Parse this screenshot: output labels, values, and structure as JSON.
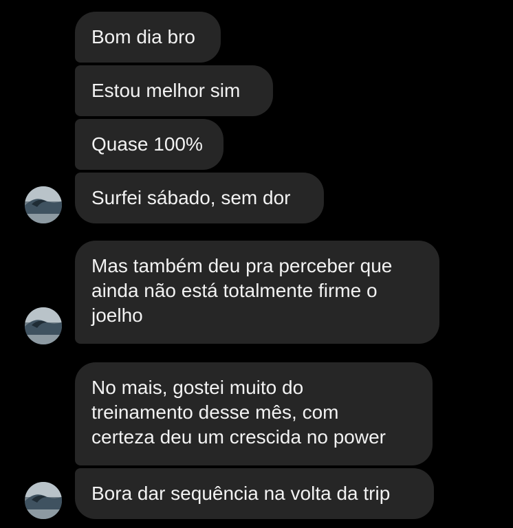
{
  "messages": [
    {
      "lines": [
        "Bom dia bro"
      ]
    },
    {
      "lines": [
        "Estou melhor sim"
      ]
    },
    {
      "lines": [
        "Quase 100%"
      ]
    },
    {
      "lines": [
        "Surfei sábado, sem dor"
      ]
    },
    {
      "lines": [
        "Mas também deu pra perceber que",
        "ainda não está totalmente firme o",
        "joelho"
      ]
    },
    {
      "lines": [
        "No mais, gostei muito do",
        "treinamento desse mês, com",
        "certeza deu um crescida no power"
      ]
    },
    {
      "lines": [
        "Bora dar sequência na volta da trip"
      ]
    }
  ],
  "colors": {
    "background": "#000000",
    "bubble": "#262626",
    "text": "#f2f2f2"
  },
  "avatar_icon": "wave-photo-avatar"
}
